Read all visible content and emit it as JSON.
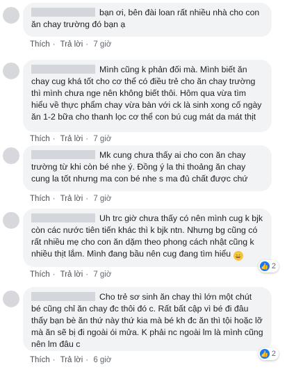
{
  "comments": [
    {
      "text": "bạn ơi, bên đài loan rất nhiều nhà cho con ăn chay trường đó bạn ạ",
      "actions": {
        "like": "Thích",
        "reply": "Trả lời",
        "time": "7 giờ"
      }
    },
    {
      "text": "Mình cũng k phản đối mà. Mình biết ăn chay cug khá tốt cho cơ thể có điều trẻ cho ăn chay trường thì mình chưa nge nên không biết thôi. Hôm qua vừa tìm hiểu về thực phẩm chay vừa bàn với ck là sinh xong cố ngày ăn 1-2 bữa cho thanh lọc cơ thể con bú cug mát da mát thịt",
      "actions": {
        "like": "Thích",
        "reply": "Trả lời",
        "time": "7 giờ"
      }
    },
    {
      "text": "Mk cung chưa thấy ai cho con ăn chay trường từ khi còn bé nhe ý. Đồng ý la thi thoảng ăn chay cung la tốt nhưng ma con bé nhe s ma đủ chất được chứ",
      "actions": {
        "like": "Thích",
        "reply": "Trả lời",
        "time": "7 giờ"
      }
    },
    {
      "text": "Uh trc giờ chưa thấy có nên mình cug k bjk còn các nước tiên tiến khác thì k bjk ntn. Nhưng bg cũng có rất nhiều mẹ cho con ăn dặm theo phong cách nhật cũng k nhiều thịt lắm. Mình đang bầu nên cug đang tìm hiểu",
      "emoji": "😄",
      "actions": {
        "like": "Thích",
        "reply": "Trả lời",
        "time": "7 giờ"
      },
      "reaction_count": "2",
      "reaction_icon": "like-icon"
    },
    {
      "text": "Cho trẻ sơ sinh ăn chay thì lớn một chút bé cũng chỉ ăn chay đc thôi đó c. Rất bất cập vì bé đi đâu thấy bạn bè ăn thứ này thứ kia mà bé kh đc ăn thì tội hoặc lỡ mà ăn sẽ bị đi ngoài ói mửa. K phải nc ngoài lm là mình cũng nên lm đâu c",
      "actions": {
        "like": "Thích",
        "reply": "Trả lời",
        "time": "6 giờ"
      },
      "reaction_count": "2",
      "reaction_icon": "like-icon"
    }
  ]
}
